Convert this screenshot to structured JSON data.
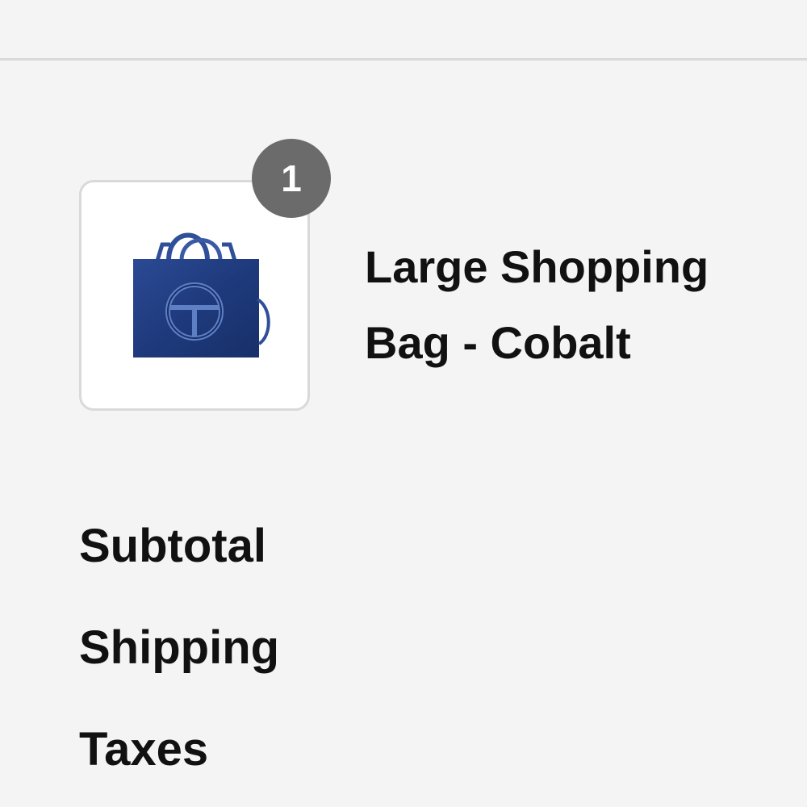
{
  "cart": {
    "items": [
      {
        "name": "Large Shopping Bag - Cobalt",
        "quantity": "1",
        "image_icon": "cobalt-shopping-bag-image"
      }
    ]
  },
  "summary": {
    "subtotal_label": "Subtotal",
    "shipping_label": "Shipping",
    "taxes_label": "Taxes"
  },
  "colors": {
    "background": "#f4f4f4",
    "badge": "#6b6b6b",
    "bag": "#1e3a7a",
    "divider": "#d9d9d9"
  }
}
